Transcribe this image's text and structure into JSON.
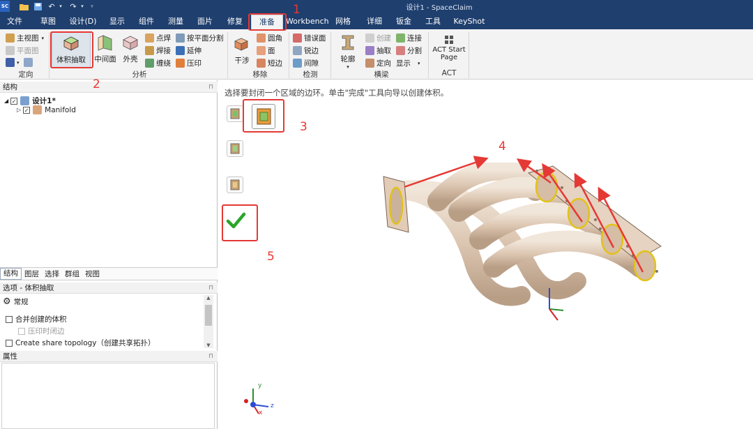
{
  "title_bar": {
    "window_title": "设计1 - SpaceClaim",
    "app_icon": "SC",
    "qa_icons": [
      "folder-icon",
      "save-icon",
      "undo-icon",
      "redo-icon"
    ]
  },
  "menu_tabs": [
    "文件",
    "草图",
    "设计(D)",
    "显示",
    "组件",
    "测量",
    "面片",
    "修复",
    "准备",
    "Workbench",
    "网格",
    "详细",
    "钣金",
    "工具",
    "KeyShot"
  ],
  "active_tab": "准备",
  "ribbon": {
    "orient_group": {
      "label": "定向",
      "home_view": "主视图",
      "plane_view": "平面图"
    },
    "analysis_group": {
      "label": "分析",
      "volume_extract": "体积抽取",
      "mid_surface": "中间面",
      "shell": "外壳",
      "spot_weld": "点焊",
      "weld": "焊接",
      "seam": "缠绕",
      "split_by_plane": "按平面分割",
      "extend": "延伸",
      "imprint": "压印"
    },
    "remove_group": {
      "label": "移除",
      "interference": "干涉",
      "rounds": "圆角",
      "faces": "面",
      "short_edges": "短边"
    },
    "detect_group": {
      "label": "检测",
      "misaligned_faces": "错误面",
      "sharp_edges": "锐边",
      "gaps": "间隙"
    },
    "beam_group": {
      "label": "横梁",
      "profile": "轮廓",
      "create": "创建",
      "extract": "抽取",
      "orient": "定向",
      "connect": "连接",
      "split": "分割",
      "display": "显示"
    },
    "act_group": {
      "label": "ACT",
      "start_page": "ACT Start Page"
    }
  },
  "structure_panel": {
    "header": "结构",
    "design_name": "设计1*",
    "component": "Manifold"
  },
  "bottom_tabs": [
    "结构",
    "图层",
    "选择",
    "群组",
    "视图"
  ],
  "options_panel": {
    "header": "选项 - 体积抽取",
    "section": "常规",
    "merge_bodies": "合并创建的体积",
    "imprint_edges": "压印时闭边",
    "share_topology": "Create share topology（创建共享拓扑）"
  },
  "properties_panel": {
    "header": "属性"
  },
  "viewport": {
    "prompt": "选择要封闭一个区域的边环。单击\"完成\"工具向导以创建体积。",
    "annotations": [
      "1",
      "2",
      "3",
      "4",
      "5"
    ],
    "triad_labels": {
      "y": "y",
      "z": "z",
      "x": "x"
    }
  },
  "colors": {
    "title_bar": "#1f3f6e",
    "highlight_red": "#e53935",
    "part_body": "#e4d3c3",
    "edge_loop": "#e2c21a"
  }
}
